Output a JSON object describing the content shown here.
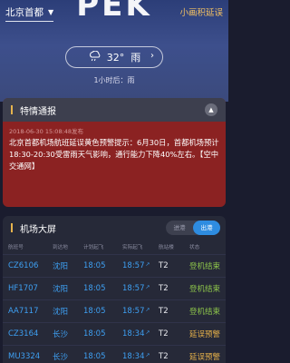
{
  "header": {
    "location": "北京首都",
    "airport_code": "PEK",
    "mini_link": "小画积延误"
  },
  "weather": {
    "temperature": "32°",
    "condition": "雨",
    "forecast": "1小时后：雨"
  },
  "alert": {
    "title": "特情通报",
    "time": "2018-06-30 15:08:48发布",
    "text": "北京首都机场航班延误黄色预警提示：6月30日，首都机场预计18:30-20:30受雷雨天气影响，通行能力下降40%左右。【空中交通网】"
  },
  "board": {
    "title": "机场大屏",
    "tabs": [
      "进港",
      "出港"
    ],
    "active_tab": "出港",
    "columns": [
      "航班号",
      "到达地",
      "计划起飞",
      "实际起飞",
      "航站楼",
      "状态"
    ],
    "rows": [
      {
        "flight": "CZ6106",
        "dest": "沈阳",
        "plan": "18:05",
        "actual": "18:57",
        "terminal": "T2",
        "status": "登机结束",
        "status_color": "#8cc34a"
      },
      {
        "flight": "HF1707",
        "dest": "沈阳",
        "plan": "18:05",
        "actual": "18:57",
        "terminal": "T2",
        "status": "登机结束",
        "status_color": "#8cc34a"
      },
      {
        "flight": "AA7117",
        "dest": "沈阳",
        "plan": "18:05",
        "actual": "18:57",
        "terminal": "T2",
        "status": "登机结束",
        "status_color": "#8cc34a"
      },
      {
        "flight": "CZ3164",
        "dest": "长沙",
        "plan": "18:05",
        "actual": "18:34",
        "terminal": "T2",
        "status": "延误预警",
        "status_color": "#e8b24a"
      },
      {
        "flight": "MU3324",
        "dest": "长沙",
        "plan": "18:05",
        "actual": "18:34",
        "terminal": "T2",
        "status": "延误预警",
        "status_color": "#e8b24a"
      }
    ]
  }
}
